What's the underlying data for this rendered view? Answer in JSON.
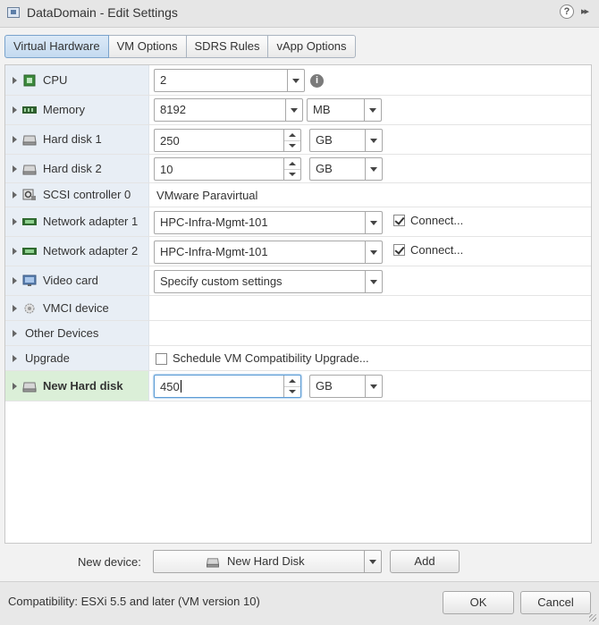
{
  "window": {
    "title": "DataDomain - Edit Settings",
    "help_glyph": "?",
    "expand_glyph": "▸▸"
  },
  "tabs": [
    {
      "label": "Virtual Hardware",
      "active": true
    },
    {
      "label": "VM Options",
      "active": false
    },
    {
      "label": "SDRS Rules",
      "active": false
    },
    {
      "label": "vApp Options",
      "active": false
    }
  ],
  "hardware": {
    "cpu": {
      "label": "CPU",
      "icon": "cpu-icon",
      "value": "2",
      "info_glyph": "i"
    },
    "memory": {
      "label": "Memory",
      "icon": "memory-icon",
      "value": "8192",
      "unit": "MB"
    },
    "hard_disk_1": {
      "label": "Hard disk 1",
      "icon": "hard-disk-icon",
      "value": "250",
      "unit": "GB"
    },
    "hard_disk_2": {
      "label": "Hard disk 2",
      "icon": "hard-disk-icon",
      "value": "10",
      "unit": "GB"
    },
    "scsi": {
      "label": "SCSI controller 0",
      "icon": "scsi-controller-icon",
      "value": "VMware Paravirtual"
    },
    "net1": {
      "label": "Network adapter 1",
      "icon": "network-adapter-icon",
      "value": "HPC-Infra-Mgmt-101",
      "connect_label": "Connect...",
      "connected": true
    },
    "net2": {
      "label": "Network adapter 2",
      "icon": "network-adapter-icon",
      "value": "HPC-Infra-Mgmt-101",
      "connect_label": "Connect...",
      "connected": true
    },
    "video": {
      "label": "Video card",
      "icon": "video-card-icon",
      "value": "Specify custom settings"
    },
    "vmci": {
      "label": "VMCI device",
      "icon": "vmci-device-icon"
    },
    "other": {
      "label": "Other Devices"
    },
    "upgrade": {
      "label": "Upgrade",
      "checkbox_label": "Schedule VM Compatibility Upgrade...",
      "checked": false
    },
    "new_disk": {
      "label": "New Hard disk",
      "icon": "hard-disk-icon",
      "value": "450",
      "unit": "GB"
    }
  },
  "new_device": {
    "label": "New device:",
    "value": "New Hard Disk",
    "add_label": "Add"
  },
  "footer": {
    "compatibility": "Compatibility: ESXi 5.5 and later (VM version 10)",
    "ok_label": "OK",
    "cancel_label": "Cancel"
  }
}
